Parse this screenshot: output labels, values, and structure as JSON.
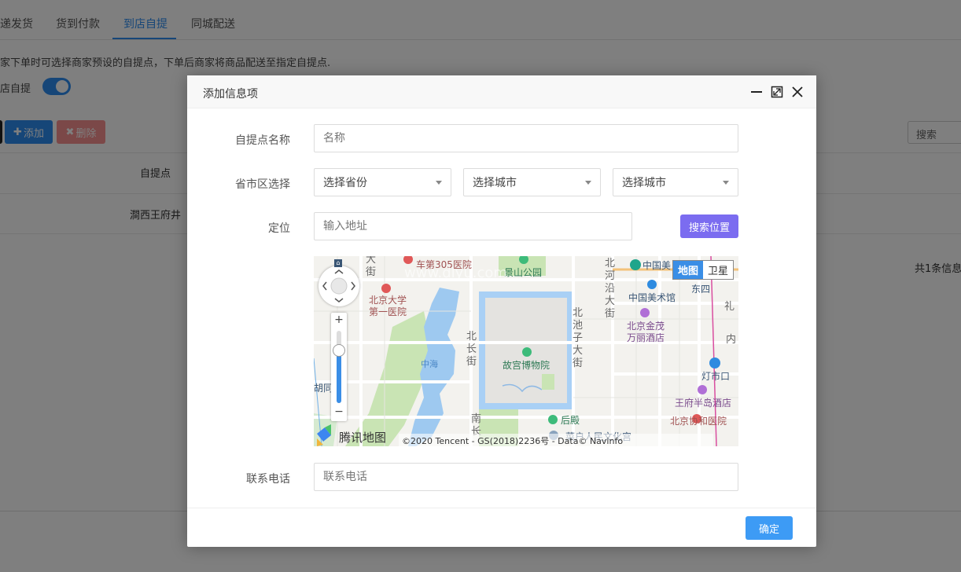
{
  "background": {
    "tabs": [
      "递发货",
      "货到付款",
      "到店自提",
      "同城配送"
    ],
    "description": "家下单时可选择商家预设的自提点，下单后商家将商品配送至指定自提点.",
    "toggle_label": "店自提",
    "add_button": "添加",
    "delete_button": "删除",
    "search_placeholder": "搜索",
    "table": {
      "header": "自提点",
      "rows": [
        "澗西王府井"
      ]
    },
    "total_info": "共1条信息"
  },
  "modal": {
    "title": "添加信息项",
    "fields": {
      "name": {
        "label": "自提点名称",
        "placeholder": "名称"
      },
      "region": {
        "label": "省市区选择",
        "province": "选择省份",
        "city": "选择城市",
        "district": "选择城市"
      },
      "location": {
        "label": "定位",
        "placeholder": "输入地址",
        "button": "搜索位置"
      },
      "phone": {
        "label": "联系电话",
        "placeholder": "联系电话"
      }
    },
    "map": {
      "type_map": "地图",
      "type_satellite": "卫星",
      "brand": "腾讯地图",
      "copyright": "©2020 Tencent - GS(2018)2236号 - Data© Navinfo",
      "watermark": "www.dlyu.com",
      "labels": {
        "hospital_305": "车第305医院",
        "jingshan": "景山公园",
        "pku_hospital_1": "北京大学",
        "pku_hospital_2": "第一医院",
        "beihe_1": "北",
        "beihe_2": "河",
        "beihe_3": "沿",
        "beihe_4": "大",
        "beihe_5": "街",
        "china_art": "中国美",
        "art_museum": "中国美术馆",
        "jinmao_1": "北京金茂",
        "jinmao_2": "万丽酒店",
        "dongsi": "东四",
        "beichi_1": "北",
        "beichi_2": "池",
        "beichi_3": "子",
        "beichi_4": "大",
        "beichi_5": "街",
        "beichang_1": "北",
        "beichang_2": "长",
        "beichang_3": "街",
        "zhonghai": "中海",
        "palace": "故宫博物院",
        "dengshikou": "灯市口",
        "peninsula": "王府半岛酒店",
        "houdian": "后殿",
        "pumc": "北京协和医院",
        "huangyuan": "菜户人民文化宫",
        "hutong": "胡同",
        "nanchang_1": "南",
        "nanchang_2": "长",
        "street_da": "大",
        "street_jie": "街",
        "li": "礼",
        "nei": "内"
      }
    },
    "ok_button": "确定"
  }
}
